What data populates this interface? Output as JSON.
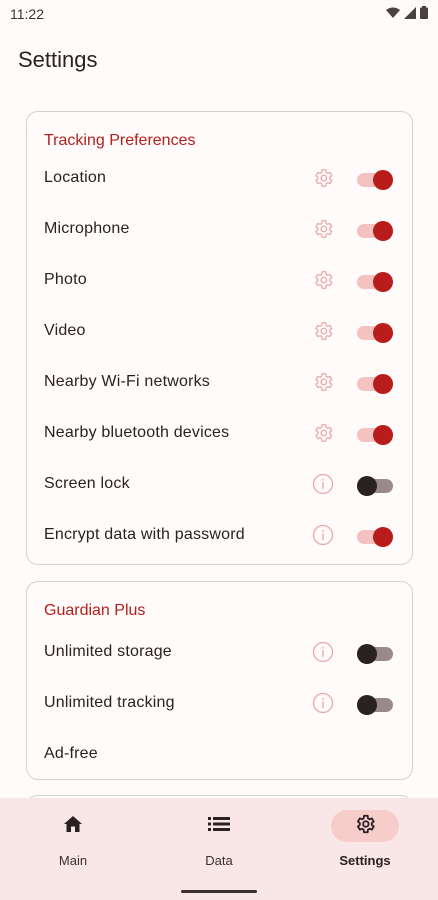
{
  "status_bar": {
    "time": "11:22",
    "icons": [
      "wifi-icon",
      "signal-icon",
      "battery-icon"
    ]
  },
  "page_title": "Settings",
  "tracking_card": {
    "title": "Tracking Preferences",
    "rows": [
      {
        "label": "Location",
        "icon": "gear-icon",
        "toggle_on": true
      },
      {
        "label": "Microphone",
        "icon": "gear-icon",
        "toggle_on": true
      },
      {
        "label": "Photo",
        "icon": "gear-icon",
        "toggle_on": true
      },
      {
        "label": "Video",
        "icon": "gear-icon",
        "toggle_on": true
      },
      {
        "label": "Nearby Wi-Fi networks",
        "icon": "gear-icon",
        "toggle_on": true
      },
      {
        "label": "Nearby bluetooth devices",
        "icon": "gear-icon",
        "toggle_on": true
      },
      {
        "label": "Screen lock",
        "icon": "info-icon",
        "toggle_on": false
      },
      {
        "label": "Encrypt data with password",
        "icon": "info-icon",
        "toggle_on": true
      }
    ]
  },
  "plus_card": {
    "title": "Guardian Plus",
    "rows": [
      {
        "label": "Unlimited storage",
        "icon": "info-icon",
        "toggle_on": false
      },
      {
        "label": "Unlimited tracking",
        "icon": "info-icon",
        "toggle_on": false
      },
      {
        "label": "Ad-free"
      }
    ]
  },
  "bottom_nav": {
    "items": [
      {
        "label": "Main",
        "icon": "home-icon",
        "active": false
      },
      {
        "label": "Data",
        "icon": "list-icon",
        "active": false
      },
      {
        "label": "Settings",
        "icon": "gear-icon",
        "active": true
      }
    ]
  },
  "colors": {
    "accent": "#b81d1c",
    "accent_light": "#f4c2c0",
    "nav_background": "#f8e7e6",
    "icon_muted": "#e8a9a7"
  }
}
